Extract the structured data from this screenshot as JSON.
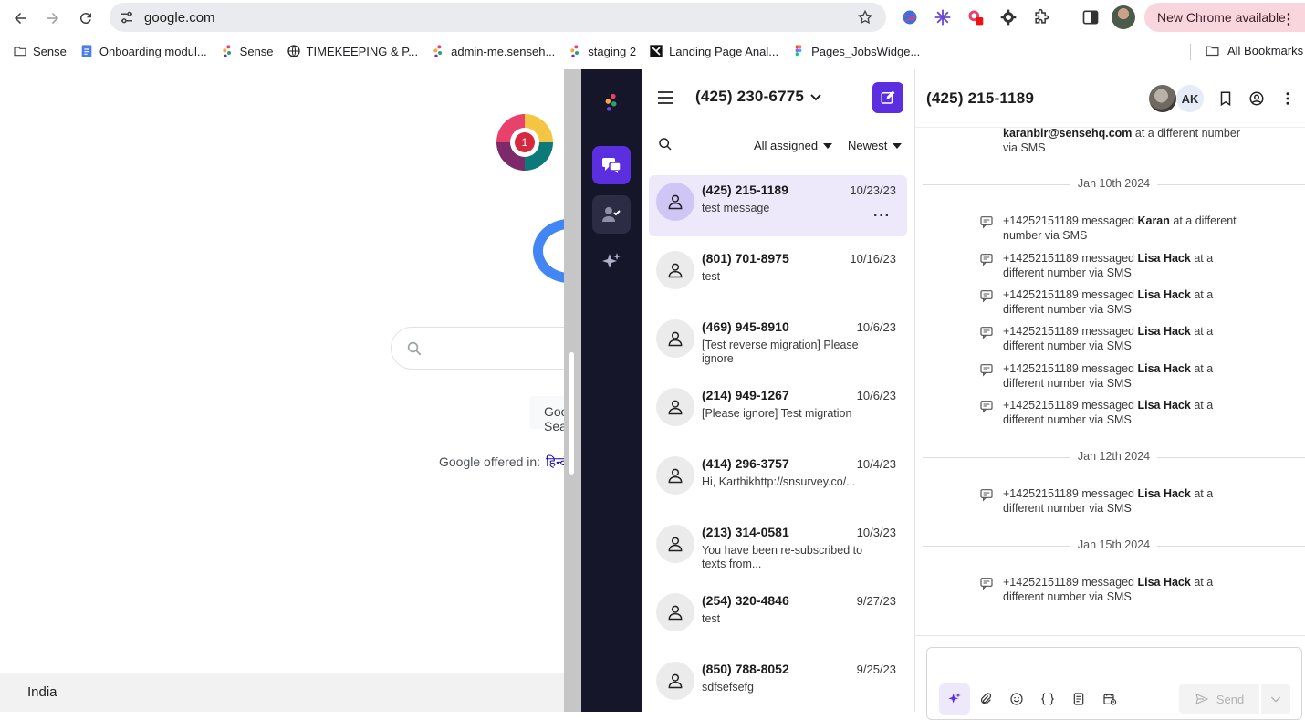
{
  "browser": {
    "url": "google.com",
    "new_chrome_label": "New Chrome available",
    "bookmarks": [
      {
        "label": "Sense",
        "icon": "folder-icon"
      },
      {
        "label": "Onboarding modul...",
        "icon": "doc-icon"
      },
      {
        "label": "Sense",
        "icon": "sense-dots-icon"
      },
      {
        "label": "TIMEKEEPING & P...",
        "icon": "globe-icon"
      },
      {
        "label": "admin-me.senseh...",
        "icon": "sense-dots-icon"
      },
      {
        "label": "staging 2",
        "icon": "sense-dots-icon"
      },
      {
        "label": "Landing Page Anal...",
        "icon": "landing-icon"
      },
      {
        "label": "Pages_JobsWidge...",
        "icon": "figma-icon"
      }
    ],
    "all_bookmarks_label": "All Bookmarks"
  },
  "google": {
    "badge_count": "1",
    "button_label": "Google Search",
    "offered_label": "Google offered in:",
    "offered_lang": "हिन्दी",
    "country": "India"
  },
  "inbox": {
    "header_phone": "(425) 230-6775",
    "filter_assigned": "All assigned",
    "filter_sort": "Newest",
    "conversations": [
      {
        "name": "(425) 215-1189",
        "date": "10/23/23",
        "snippet": "test message",
        "selected": true
      },
      {
        "name": "(801) 701-8975",
        "date": "10/16/23",
        "snippet": "test"
      },
      {
        "name": "(469) 945-8910",
        "date": "10/6/23",
        "snippet": "[Test reverse migration] Please ignore"
      },
      {
        "name": "(214) 949-1267",
        "date": "10/6/23",
        "snippet": "[Please ignore] Test migration"
      },
      {
        "name": "(414) 296-3757",
        "date": "10/4/23",
        "snippet": "Hi, Karthikhttp://snsurvey.co/..."
      },
      {
        "name": "(213) 314-0581",
        "date": "10/3/23",
        "snippet": "You have been re-subscribed to texts from..."
      },
      {
        "name": "(254) 320-4846",
        "date": "9/27/23",
        "snippet": "test"
      },
      {
        "name": "(850) 788-8052",
        "date": "9/25/23",
        "snippet": "sdfsefsefg"
      }
    ]
  },
  "detail": {
    "title": "(425) 215-1189",
    "avatar_initials": "AK",
    "feed_top": {
      "user": "karanbir@sensehq.com",
      "rest": " at a different number via SMS"
    },
    "groups": [
      {
        "date": "Jan 10th 2024",
        "items": [
          {
            "from": "+14252151189 messaged ",
            "who": "Karan",
            "rest": " at a different number via SMS"
          },
          {
            "from": "+14252151189 messaged ",
            "who": "Lisa Hack",
            "rest": " at a different number via SMS"
          },
          {
            "from": "+14252151189 messaged ",
            "who": "Lisa Hack",
            "rest": " at a different number via SMS"
          },
          {
            "from": "+14252151189 messaged ",
            "who": "Lisa Hack",
            "rest": " at a different number via SMS"
          },
          {
            "from": "+14252151189 messaged ",
            "who": "Lisa Hack",
            "rest": " at a different number via SMS"
          },
          {
            "from": "+14252151189 messaged ",
            "who": "Lisa Hack",
            "rest": " at a different number via SMS"
          }
        ]
      },
      {
        "date": "Jan 12th 2024",
        "items": [
          {
            "from": "+14252151189 messaged ",
            "who": "Lisa Hack",
            "rest": " at a different number via SMS"
          }
        ]
      },
      {
        "date": "Jan 15th 2024",
        "items": [
          {
            "from": "+14252151189 messaged ",
            "who": "Lisa Hack",
            "rest": " at a different number via SMS"
          }
        ]
      }
    ],
    "send_label": "Send"
  },
  "colors": {
    "accent": "#5b2ee0",
    "rail": "#16162a",
    "selected_row": "#ede9fb"
  }
}
